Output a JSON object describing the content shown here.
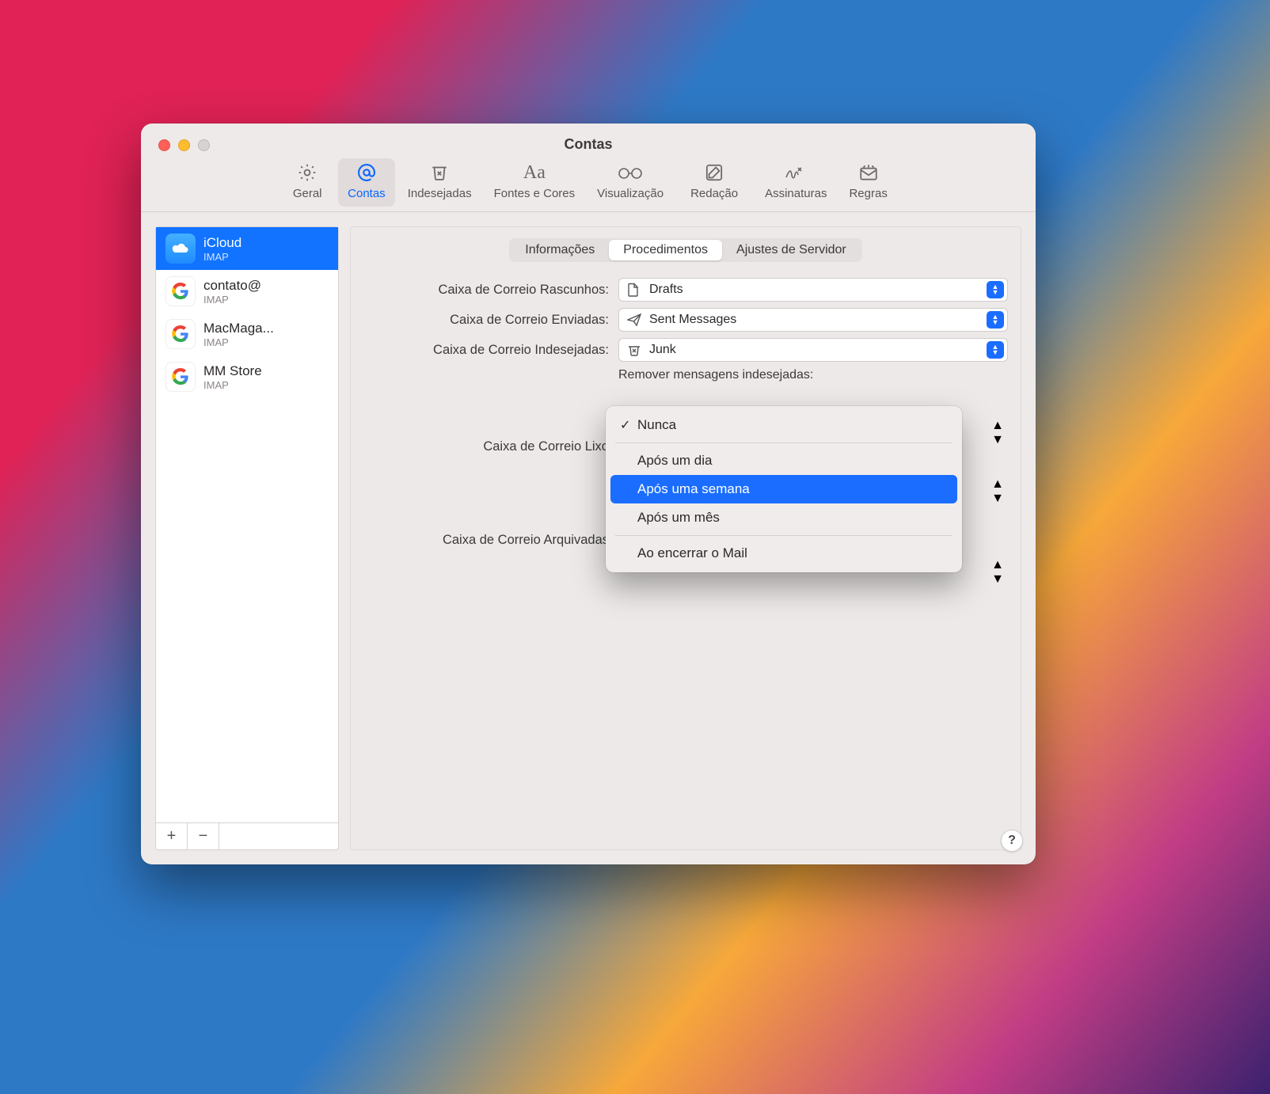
{
  "window": {
    "title": "Contas"
  },
  "toolbar": {
    "items": [
      {
        "label": "Geral"
      },
      {
        "label": "Contas"
      },
      {
        "label": "Indesejadas"
      },
      {
        "label": "Fontes e Cores"
      },
      {
        "label": "Visualização"
      },
      {
        "label": "Redação"
      },
      {
        "label": "Assinaturas"
      },
      {
        "label": "Regras"
      }
    ]
  },
  "sidebar": {
    "accounts": [
      {
        "name": "iCloud",
        "sub": "IMAP"
      },
      {
        "name": "contato@",
        "sub": "IMAP"
      },
      {
        "name": "MacMaga...",
        "sub": "IMAP"
      },
      {
        "name": "MM Store",
        "sub": "IMAP"
      }
    ],
    "add": "+",
    "remove": "−"
  },
  "tabs": {
    "items": [
      {
        "label": "Informações"
      },
      {
        "label": "Procedimentos"
      },
      {
        "label": "Ajustes de Servidor"
      }
    ]
  },
  "form": {
    "drafts_label": "Caixa de Correio Rascunhos:",
    "drafts_value": "Drafts",
    "sent_label": "Caixa de Correio Enviadas:",
    "sent_value": "Sent Messages",
    "junk_label": "Caixa de Correio Indesejadas:",
    "junk_value": "Junk",
    "junk_remove_label": "Remover mensagens indesejadas:",
    "trash_label": "Caixa de Correio Lixo",
    "archive_label": "Caixa de Correio Arquivadas"
  },
  "menu": {
    "nunca": "Nunca",
    "dia": "Após um dia",
    "semana": "Após uma semana",
    "mes": "Após um mês",
    "sair": "Ao encerrar o Mail"
  },
  "help": "?"
}
